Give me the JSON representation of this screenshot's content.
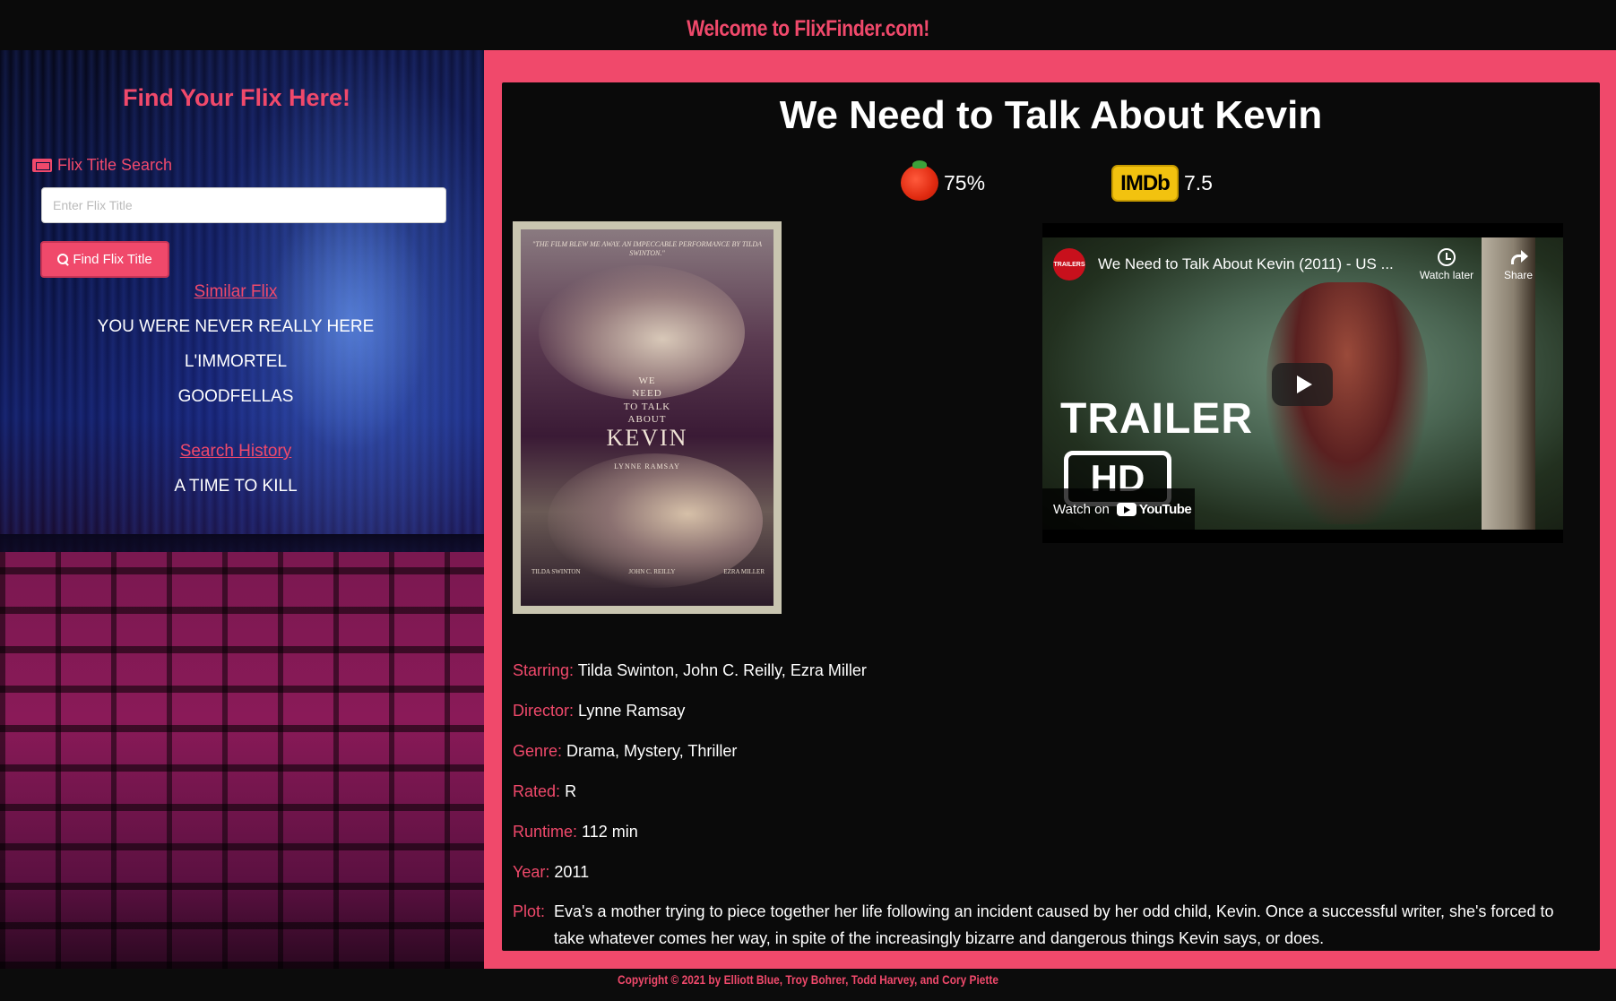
{
  "header": {
    "site_title": "Welcome to FlixFinder.com!"
  },
  "sidebar": {
    "heading": "Find Your Flix Here!",
    "search_label": "Flix Title Search",
    "search_placeholder": "Enter Flix Title",
    "search_value": "",
    "find_button_label": "Find Flix Title",
    "similar_heading": "Similar Flix",
    "similar_items": [
      "YOU WERE NEVER REALLY HERE",
      "L'IMMORTEL",
      "GOODFELLAS"
    ],
    "history_heading": "Search History",
    "history_items": [
      "A TIME TO KILL"
    ]
  },
  "movie": {
    "title": "We Need to Talk About Kevin",
    "rotten_tomatoes": "75%",
    "imdb_badge": "IMDb",
    "imdb_rating": "7.5",
    "poster": {
      "quote": "\"THE FILM BLEW ME AWAY. AN IMPECCABLE PERFORMANCE BY TILDA SWINTON.\"",
      "small_title": [
        "WE",
        "NEED",
        "TO TALK",
        "ABOUT"
      ],
      "big_title": "KEVIN",
      "director": "LYNNE RAMSAY",
      "credits": [
        "TILDA SWINTON",
        "JOHN C. REILLY",
        "EZRA MILLER"
      ]
    },
    "trailer": {
      "channel_badge": "TRAILERS",
      "video_title": "We Need to Talk About Kevin (2011) - US ...",
      "watch_later": "Watch later",
      "share": "Share",
      "overlay_text": "TRAILER",
      "hd_text": "HD",
      "watch_on": "Watch on",
      "youtube": "YouTube"
    },
    "details": [
      {
        "label": "Starring:",
        "value": "Tilda Swinton, John C. Reilly, Ezra Miller"
      },
      {
        "label": "Director:",
        "value": "Lynne Ramsay"
      },
      {
        "label": "Genre:",
        "value": "Drama, Mystery, Thriller"
      },
      {
        "label": "Rated:",
        "value": "R"
      },
      {
        "label": "Runtime:",
        "value": "112 min"
      },
      {
        "label": "Year:",
        "value": "2011"
      }
    ],
    "plot_label": "Plot:",
    "plot": "Eva's a mother trying to piece together her life following an incident caused by her odd child, Kevin. Once a successful writer, she's forced to take whatever comes her way, in spite of the increasingly bizarre and dangerous things Kevin says, or does."
  },
  "footer": {
    "copyright": "Copyright © 2021 by Elliott Blue, Troy Bohrer, Todd Harvey, and Cory Piette"
  },
  "colors": {
    "accent": "#f0496b",
    "card_bg": "#0a0a0a",
    "imdb_yellow": "#f2c20f"
  }
}
